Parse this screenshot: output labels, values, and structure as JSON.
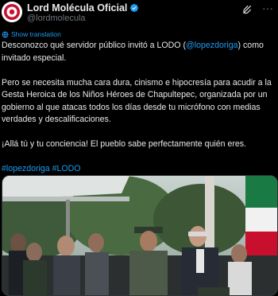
{
  "author": {
    "display_name": "Lord Molécula Oficial",
    "handle": "@lordmolecula",
    "avatar_icon": "avatar-logo-icon",
    "verified_icon": "verified-badge-icon"
  },
  "actions": {
    "grok_icon": "grok-icon",
    "more_label": "···"
  },
  "translate": {
    "label": "Show translation"
  },
  "post": {
    "p1_before": "Desconozco qué servidor público invitó a LODO (",
    "p1_mention": "@lopezdoriga",
    "p1_after": ") como invitado especial.",
    "p2": "Pero se necesita mucha cara dura, cinismo e hipocresía para acudir a la Gesta Heroica de los Niños Héroes de Chapultepec, organizada por un gobierno al que atacas todos los días desde tu micrófono con medias verdades y descalificaciones.",
    "p3": "¡Allá tú y tu conciencia! El pueblo sabe perfectamente quién eres.",
    "hashtag1": "#lopezdoriga",
    "hashtag2": "#LODO"
  },
  "media": {
    "type": "photo",
    "description_icon": "photo-ceremony-image"
  },
  "colors": {
    "background": "#000000",
    "text": "#e7e9ea",
    "secondary": "#71767b",
    "accent": "#1d9bf0"
  }
}
